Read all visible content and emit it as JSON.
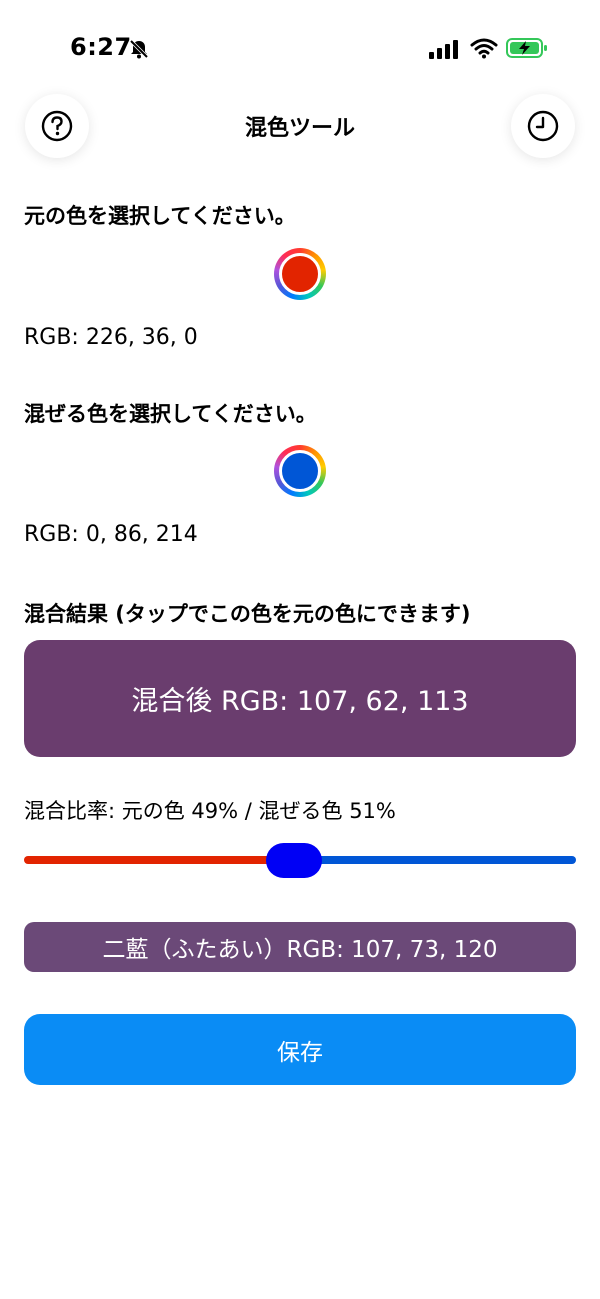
{
  "status_bar": {
    "time": "6:27"
  },
  "nav": {
    "title": "混色ツール",
    "help_icon": "question-circle-icon",
    "history_icon": "clock-icon"
  },
  "original": {
    "label": "元の色を選択してください。",
    "color": "#e22400",
    "rgb_text": "RGB: 226, 36, 0"
  },
  "mix": {
    "label": "混ぜる色を選択してください。",
    "color": "#0056d6",
    "rgb_text": "RGB: 0, 86, 214"
  },
  "result": {
    "label": "混合結果 (タップでこの色を元の色にできます)",
    "color": "#6a3d6e",
    "text": "混合後 RGB: 107, 62, 113"
  },
  "ratio": {
    "text": "混合比率: 元の色 49% / 混ぜる色 51%",
    "value": 0.49,
    "thumb_color": "#0000f5"
  },
  "named_color": {
    "color": "#6b4978",
    "text": "二藍（ふたあい）RGB: 107, 73, 120"
  },
  "save_button": {
    "label": "保存",
    "color": "#0a8cf5"
  }
}
